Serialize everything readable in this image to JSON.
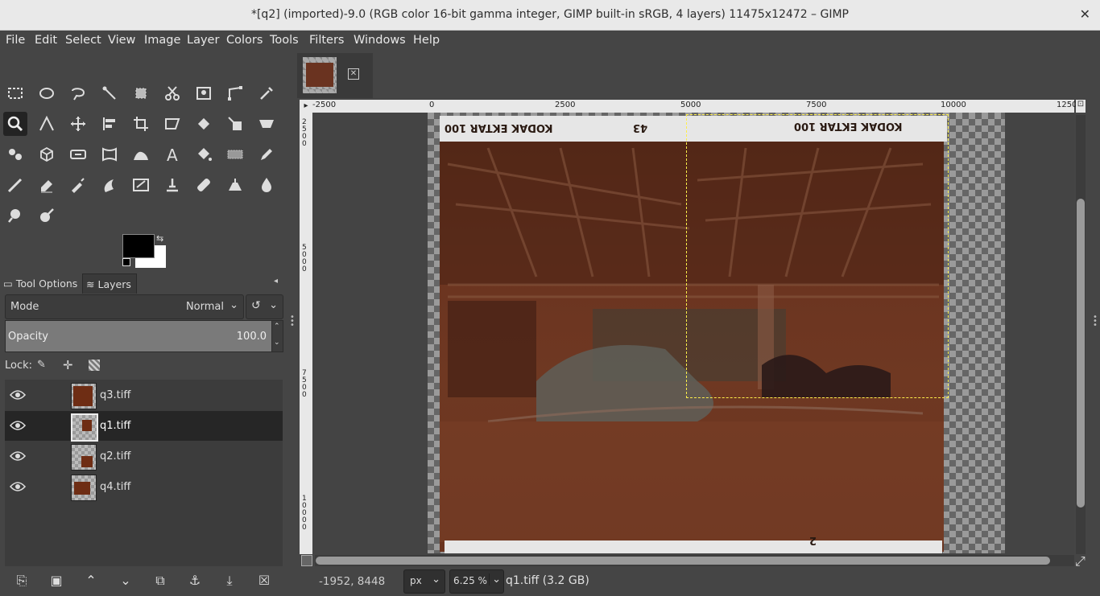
{
  "window": {
    "title": "*[q2] (imported)-9.0 (RGB color 16-bit gamma integer, GIMP built-in sRGB, 4 layers) 11475x12472 – GIMP",
    "close_glyph": "✕"
  },
  "menu": [
    "File",
    "Edit",
    "Select",
    "View",
    "Image",
    "Layer",
    "Colors",
    "Tools",
    "Filters",
    "Windows",
    "Help"
  ],
  "tools": [
    "rect-select",
    "ellipse-select",
    "free-select",
    "fuzzy-select",
    "by-color-select",
    "scissors",
    "foreground-select",
    "paths",
    "color-picker",
    "zoom",
    "measure",
    "move",
    "align",
    "crop",
    "unified-transform",
    "warp-transform",
    "flip",
    "perspective",
    "cage",
    "3d-transform",
    "handle-transform",
    "seamless-clone",
    "smudge",
    "text",
    "bucket-fill",
    "gradient",
    "pencil",
    "paintbrush",
    "eraser",
    "airbrush",
    "ink",
    "mypaint-brush",
    "clone",
    "heal",
    "perspective-clone",
    "blur",
    "dodge",
    "smudge-brush"
  ],
  "colors": {
    "foreground": "#000000",
    "background": "#ffffff",
    "accent_selection": "#ffef4a"
  },
  "dock": {
    "tabs": [
      {
        "label": "Tool Options",
        "icon": "tool-options-icon"
      },
      {
        "label": "Layers",
        "icon": "layers-icon"
      }
    ],
    "mode_label": "Mode",
    "mode_value": "Normal",
    "opacity_label": "Opacity",
    "opacity_value": "100.0",
    "lock_label": "Lock:",
    "layers": [
      {
        "name": "q3.tiff",
        "selected": false
      },
      {
        "name": "q1.tiff",
        "selected": true
      },
      {
        "name": "q2.tiff",
        "selected": false
      },
      {
        "name": "q4.tiff",
        "selected": false
      }
    ]
  },
  "ruler": {
    "h_labels": [
      "-2500",
      "0",
      "2500",
      "5000",
      "7500",
      "10000",
      "1250"
    ],
    "v_labels": [
      "2500",
      "5000",
      "7500",
      "10000"
    ]
  },
  "film_text": {
    "left": "KODAK EKTAR 100",
    "mid": "43",
    "right": "KODAK EKTAR 100",
    "bottom": "2"
  },
  "status": {
    "coords": "-1952, 8448",
    "unit": "px",
    "zoom": "6.25 %",
    "info": "q1.tiff (3.2 GB)"
  }
}
